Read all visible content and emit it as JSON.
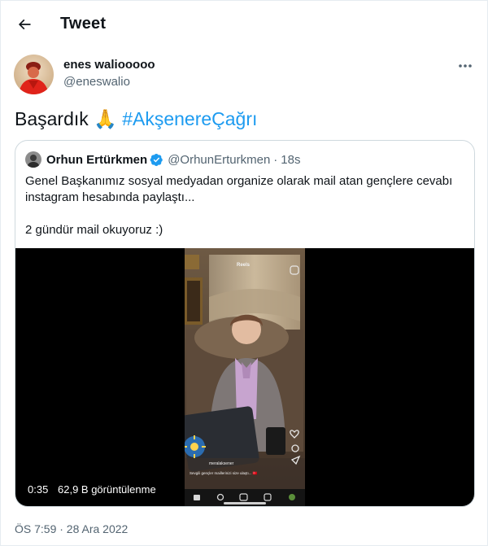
{
  "header": {
    "title": "Tweet"
  },
  "tweet": {
    "display_name": "enes waliooooo",
    "handle": "@eneswalio",
    "text_main": "Başardık",
    "emoji": "🙏",
    "hashtag": "#AkşenereÇağrı",
    "timestamp": "ÖS 7:59 · 28 Ara 2022"
  },
  "quote": {
    "display_name": "Orhun Ertürkmen",
    "handle": "@OrhunErturkmen",
    "separator": "·",
    "time": "18s",
    "text_line1": "Genel Başkanımız sosyal medyadan organize olarak mail atan gençlere cevabı",
    "text_line2": "instagram hesabında paylaştı...",
    "text_line3": "2 gündür mail okuyoruz :)",
    "video": {
      "duration": "0:35",
      "views": "62,9 B görüntülenme",
      "phone_header": "Reels",
      "phone_user": "meralaksener",
      "phone_caption": "Sevgili gençler maillerinizi size ulaştı... 🇹🇷"
    }
  },
  "colors": {
    "accent": "#1d9bf0",
    "secondary_text": "#536471",
    "border": "#cfd9de"
  },
  "icons": {
    "back": "arrow-left-icon",
    "more": "more-horizontal-icon",
    "verified": "verified-badge-icon"
  }
}
